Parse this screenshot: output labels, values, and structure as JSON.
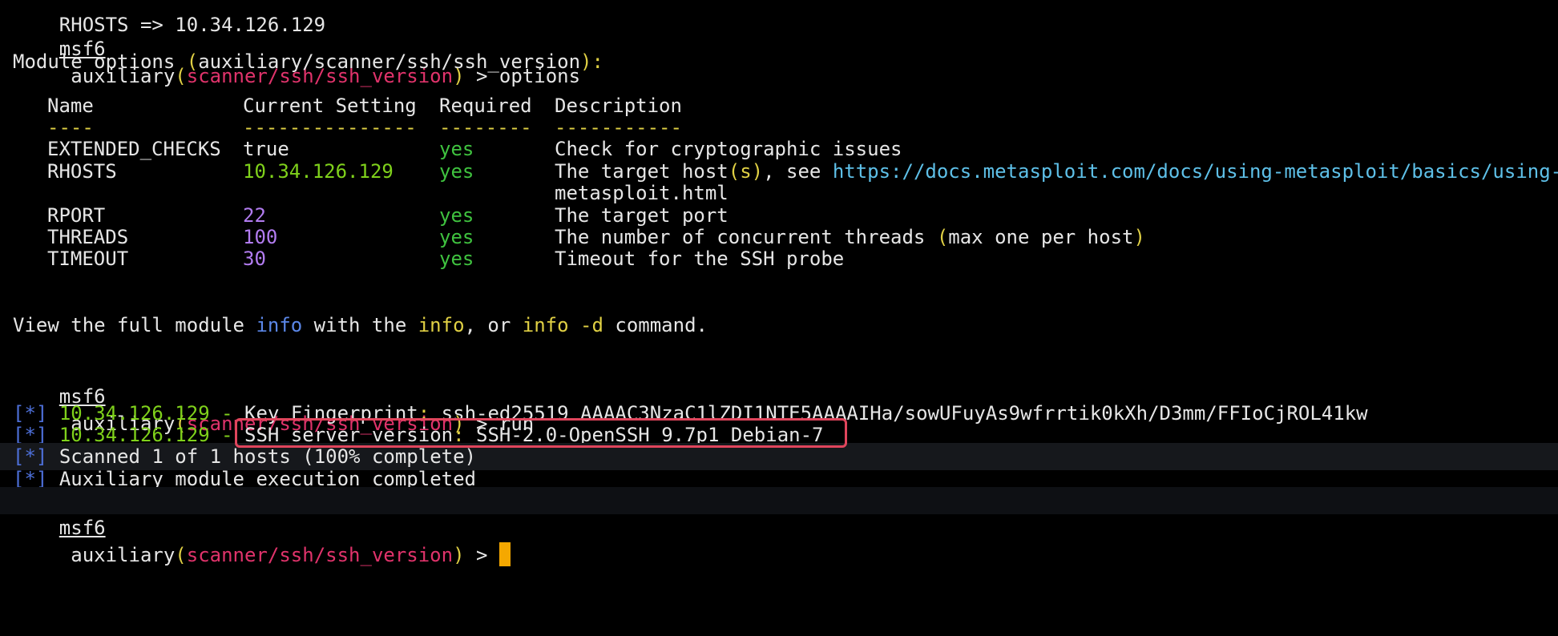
{
  "colors": {
    "background": "#000000",
    "module_name": "#e0336b",
    "highlight_box": "#e0455c",
    "cursor": "#f5a800",
    "ok_green": "#3fc23f",
    "number_purple": "#b27cf0",
    "link": "#5ec0e8"
  },
  "top_partial": "RHOSTS => 10.34.126.129",
  "prompt": {
    "name": "msf6",
    "type": "auxiliary",
    "module": "scanner/ssh/ssh_version",
    "arrow": ">"
  },
  "cmd_options": "options",
  "options_header_prefix": "Module options ",
  "options_header_module": "auxiliary/scanner/ssh/ssh_version",
  "table": {
    "headers": [
      "Name",
      "Current Setting",
      "Required",
      "Description"
    ],
    "dashes": [
      "----",
      "---------------",
      "--------",
      "-----------"
    ],
    "rows": [
      {
        "name": "EXTENDED_CHECKS",
        "setting": "true",
        "required": "yes",
        "desc": "Check for cryptographic issues"
      },
      {
        "name": "RHOSTS",
        "setting": "10.34.126.129",
        "required": "yes",
        "desc_prefix": "The target host",
        "desc_paren": "(s)",
        "desc_mid": ", see ",
        "desc_link1": "https://docs.metasploit.com/docs/using-metasploit/basics/using-",
        "desc_link2": "metasploit.html"
      },
      {
        "name": "RPORT",
        "setting": "22",
        "required": "yes",
        "desc": "The target port"
      },
      {
        "name": "THREADS",
        "setting": "100",
        "required": "yes",
        "desc_prefix": "The number of concurrent threads ",
        "desc_paren_open": "(",
        "desc_paren_text": "max one per host",
        "desc_paren_close": ")"
      },
      {
        "name": "TIMEOUT",
        "setting": "30",
        "required": "yes",
        "desc": "Timeout for the SSH probe"
      }
    ]
  },
  "info_line": {
    "p1": "View the full module ",
    "info1": "info",
    "p2": " with the ",
    "info2": "info",
    "p3": ", or ",
    "info3": "info -d",
    "p4": " command."
  },
  "cmd_run": "run",
  "output": {
    "bracket": "[*]",
    "ip": "10.34.126.129",
    "dash": " - ",
    "fingerprint_label": "Key Fingerprint",
    "fingerprint_value": " ssh-ed25519 AAAAC3NzaC1lZDI1NTE5AAAAIHa/sowUFuyAs9wfrrtik0kXh/D3mm/FFIoCjROL41kw",
    "version_label": "SSH server version",
    "version_value": " SSH-2.0-OpenSSH_9.7p1 Debian-7",
    "scanned": "Scanned 1 of 1 hosts (100% complete)",
    "completed": "Auxiliary module execution completed"
  }
}
